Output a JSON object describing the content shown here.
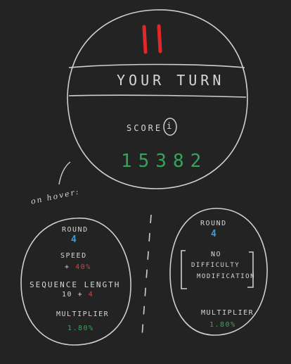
{
  "header": {
    "title": "YOUR TURN"
  },
  "score": {
    "label": "SCORE",
    "info_symbol": "i",
    "value": "15382"
  },
  "hover_caption": "on hover:",
  "left_panel": {
    "round_label": "ROUND",
    "round_value": "4",
    "speed_label": "SPEED",
    "speed_prefix": "+",
    "speed_value": "40%",
    "sequence_label": "SEQUENCE LENGTH",
    "sequence_base": "10",
    "sequence_plus": "+",
    "sequence_extra": "4",
    "multiplier_label": "MULTIPLIER",
    "multiplier_value": "1.80%"
  },
  "right_panel": {
    "round_label": "ROUND",
    "round_value": "4",
    "no_mod_line1": "NO",
    "no_mod_line2": "DIFFICULTY",
    "no_mod_line3": "MODIFICATION",
    "multiplier_label": "MULTIPLIER",
    "multiplier_value": "1.80%"
  },
  "colors": {
    "background": "#232323",
    "stroke": "#cfcfcf",
    "pause_red": "#e0282b",
    "accent_blue": "#3b9dd8",
    "accent_red": "#e53b3b",
    "accent_green": "#35a55a"
  },
  "icons": {
    "pause": "pause-icon",
    "info": "info-icon"
  }
}
